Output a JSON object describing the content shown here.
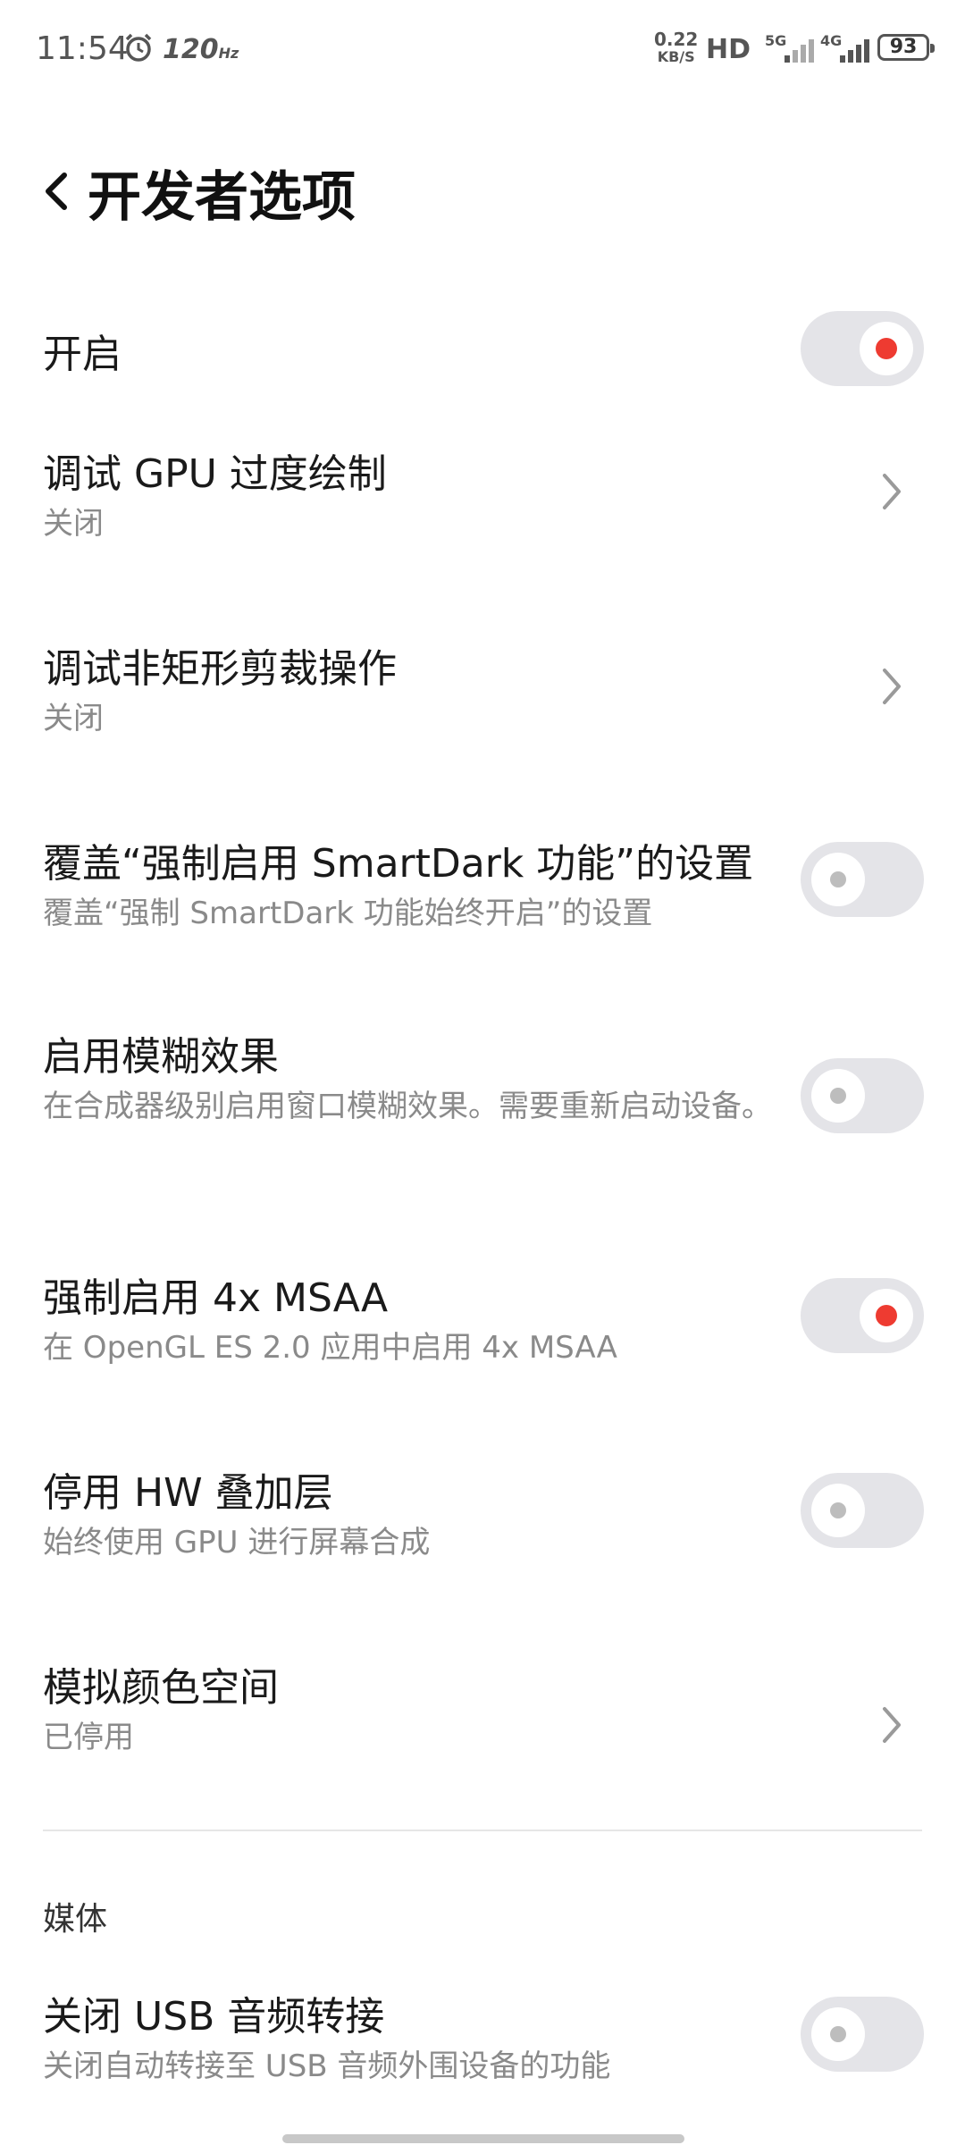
{
  "status_bar": {
    "time": "11:54",
    "alarm_icon": "alarm-clock-icon",
    "refresh": "120",
    "refresh_unit": "Hz",
    "speed_value": "0.22",
    "speed_unit": "KB/S",
    "hd": "HD",
    "net1": "5G",
    "net2": "4G",
    "battery": "93"
  },
  "header": {
    "title": "开发者选项",
    "back_icon": "chevron-left-icon"
  },
  "items": [
    {
      "title": "开启",
      "subtitle": "",
      "control": "toggle",
      "on": true
    },
    {
      "title": "调试 GPU 过度绘制",
      "subtitle": "关闭",
      "control": "chevron"
    },
    {
      "title": "调试非矩形剪裁操作",
      "subtitle": "关闭",
      "control": "chevron"
    },
    {
      "title": "覆盖“强制启用 SmartDark 功能”的设置",
      "subtitle": "覆盖“强制 SmartDark 功能始终开启”的设置",
      "control": "toggle",
      "on": false
    },
    {
      "title": "启用模糊效果",
      "subtitle": "在合成器级别启用窗口模糊效果。需要重新启动设备。",
      "control": "toggle",
      "on": false
    },
    {
      "title": "强制启用 4x MSAA",
      "subtitle": "在 OpenGL ES 2.0 应用中启用 4x MSAA",
      "control": "toggle",
      "on": true
    },
    {
      "title": "停用 HW 叠加层",
      "subtitle": "始终使用 GPU 进行屏幕合成",
      "control": "toggle",
      "on": false
    },
    {
      "title": "模拟颜色空间",
      "subtitle": "已停用",
      "control": "chevron"
    },
    {
      "title": "关闭 USB 音频转接",
      "subtitle": "关闭自动转接至 USB 音频外围设备的功能",
      "control": "toggle",
      "on": false
    }
  ],
  "section_media": "媒体",
  "colors": {
    "accent": "#ee3b31",
    "toggle_track": "#e4e4e8",
    "subtitle": "#8a8a8a"
  }
}
